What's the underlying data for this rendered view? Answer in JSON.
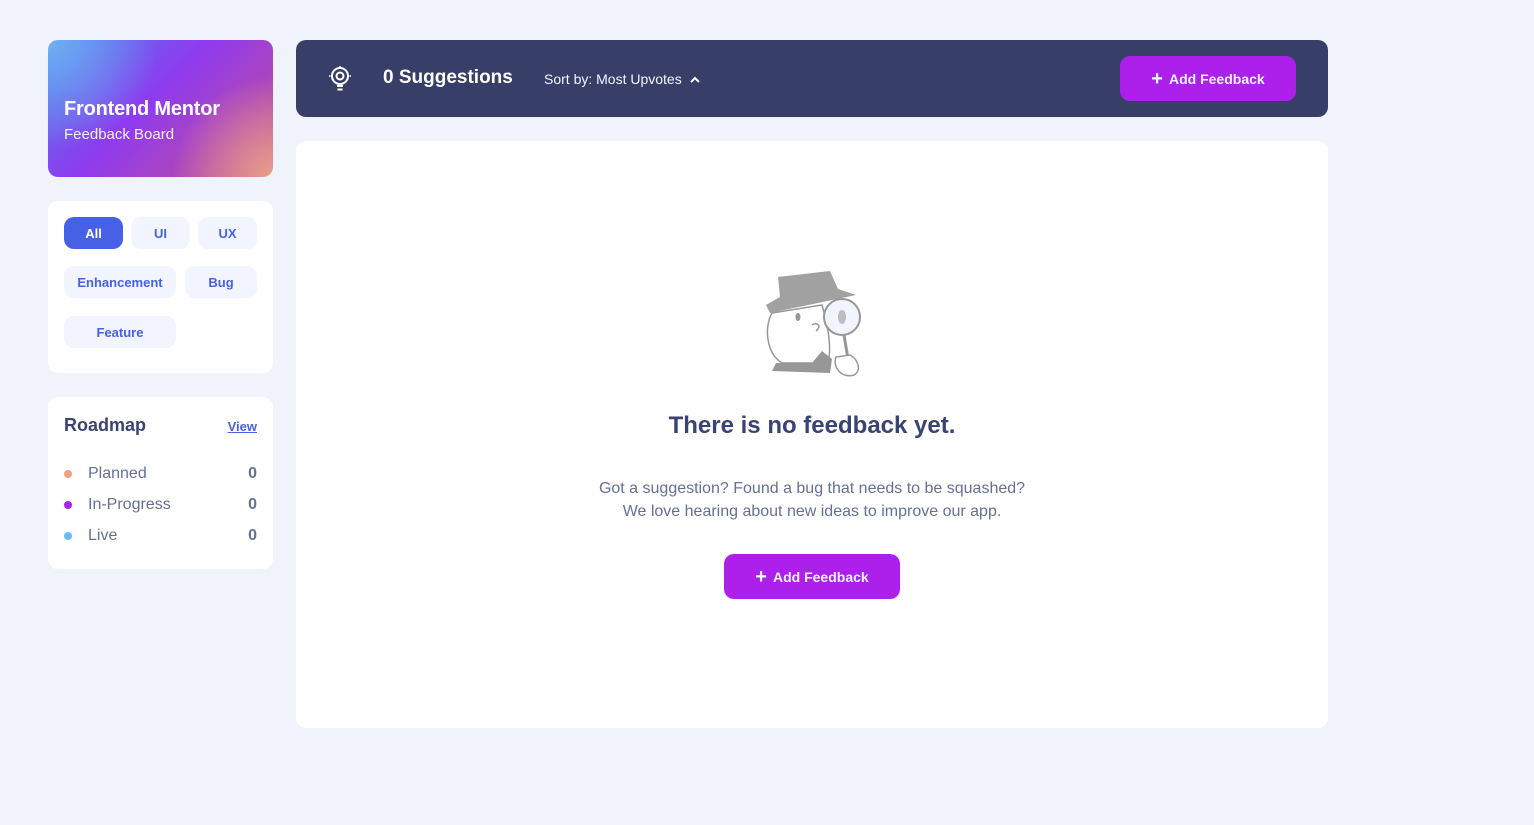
{
  "brand": {
    "title": "Frontend Mentor",
    "subtitle": "Feedback Board"
  },
  "filters": {
    "items": [
      {
        "label": "All",
        "active": true
      },
      {
        "label": "UI",
        "active": false
      },
      {
        "label": "UX",
        "active": false
      },
      {
        "label": "Enhancement",
        "active": false
      },
      {
        "label": "Bug",
        "active": false
      },
      {
        "label": "Feature",
        "active": false
      }
    ]
  },
  "roadmap": {
    "title": "Roadmap",
    "view_label": "View",
    "items": [
      {
        "label": "Planned",
        "count": "0",
        "color": "#F49F85"
      },
      {
        "label": "In-Progress",
        "count": "0",
        "color": "#AD1FEA"
      },
      {
        "label": "Live",
        "count": "0",
        "color": "#62BCFA"
      }
    ]
  },
  "header": {
    "suggestion_count": "0 Suggestions",
    "sort_label": "Sort by: Most Upvotes",
    "add_button_label": "Add Feedback"
  },
  "empty_state": {
    "title": "There is no feedback yet.",
    "line1": "Got a suggestion? Found a bug that needs to be squashed?",
    "line2": "We love hearing about new ideas to improve our app.",
    "add_button_label": "Add Feedback"
  },
  "colors": {
    "accent_purple": "#AD1FEA",
    "accent_blue": "#4661E6",
    "header_bg": "#373F68",
    "page_bg": "#F0F3FC"
  }
}
